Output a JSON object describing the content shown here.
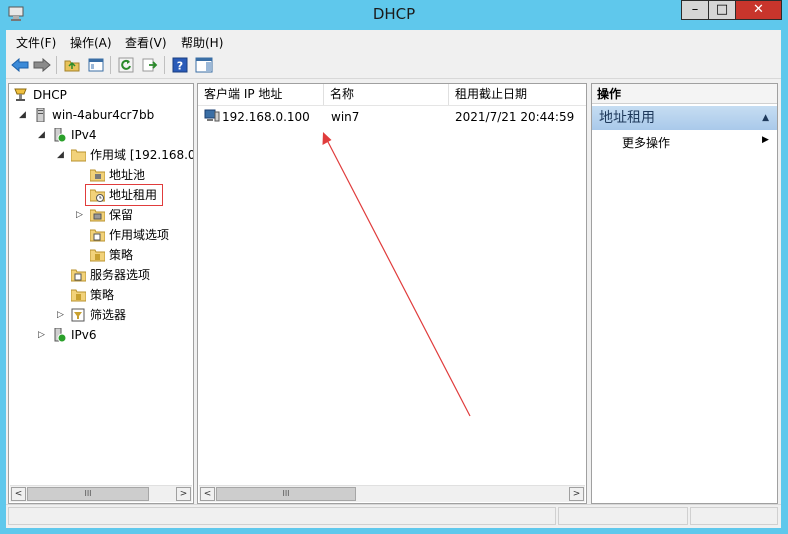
{
  "window": {
    "title": "DHCP"
  },
  "menu": [
    "文件(F)",
    "操作(A)",
    "查看(V)",
    "帮助(H)"
  ],
  "tree": {
    "root": "DHCP",
    "server": "win-4abur4cr7bb",
    "ipv4": "IPv4",
    "scope": "作用域 [192.168.0.",
    "pool": "地址池",
    "leases": "地址租用",
    "reservations": "保留",
    "scope_options": "作用域选项",
    "scope_policies": "策略",
    "server_options": "服务器选项",
    "policies": "策略",
    "filters": "筛选器",
    "ipv6": "IPv6"
  },
  "list": {
    "columns": [
      "客户端 IP 地址",
      "名称",
      "租用截止日期"
    ],
    "rows": [
      {
        "ip": "192.168.0.100",
        "name": "win7",
        "expiry": "2021/7/21 20:44:59"
      }
    ]
  },
  "actions": {
    "title": "操作",
    "section": "地址租用",
    "more": "更多操作"
  },
  "colors": {
    "titlebar": "#5fc8ec",
    "highlight_box": "#e03c3c",
    "arrow": "#e03c3c"
  }
}
